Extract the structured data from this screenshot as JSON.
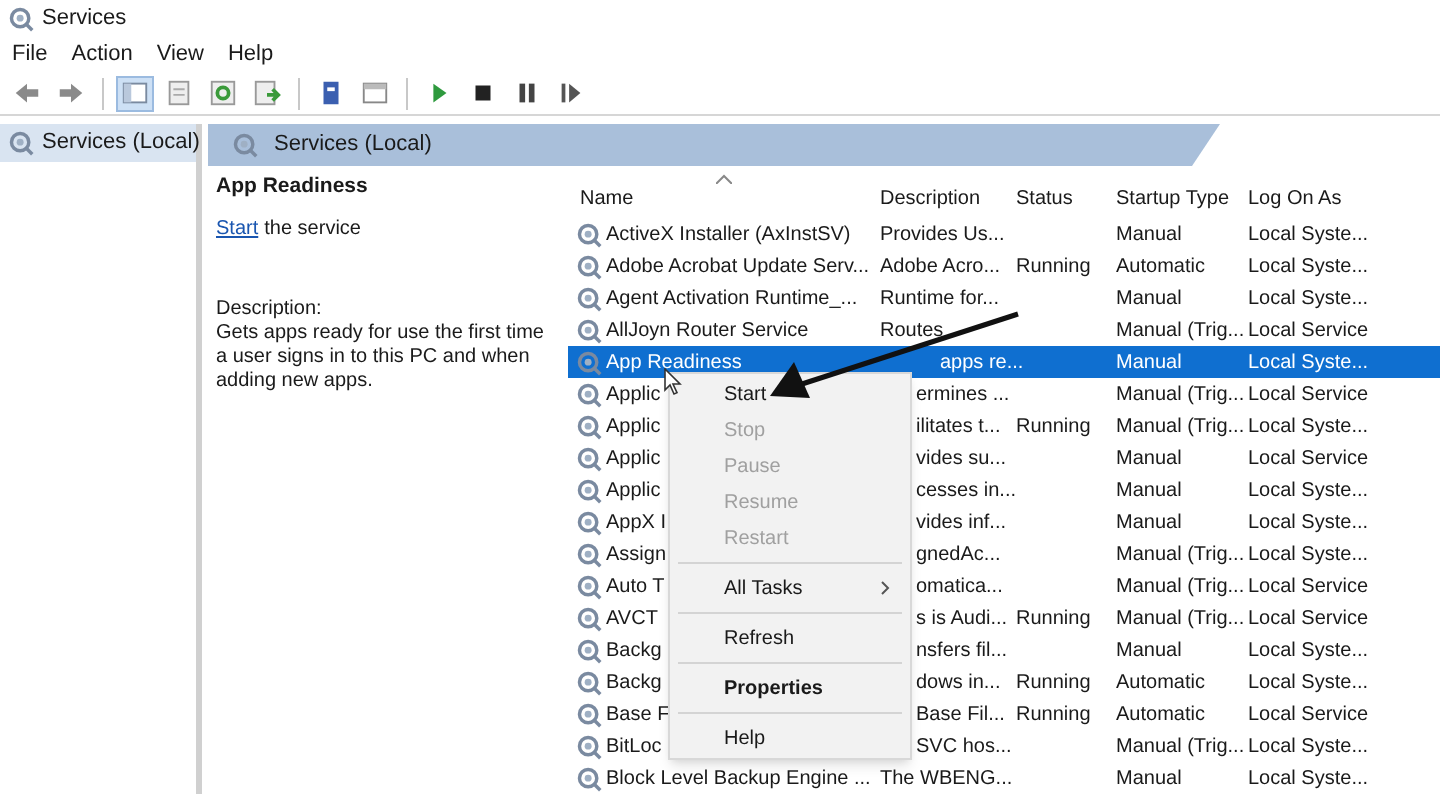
{
  "window": {
    "title": "Services"
  },
  "menu_bar": [
    "File",
    "Action",
    "View",
    "Help"
  ],
  "toolbar": [
    {
      "kind": "back",
      "selected": false
    },
    {
      "kind": "forward",
      "selected": false
    },
    {
      "kind": "sep"
    },
    {
      "kind": "tree",
      "selected": true
    },
    {
      "kind": "properties",
      "selected": false
    },
    {
      "kind": "refresh",
      "selected": false
    },
    {
      "kind": "export",
      "selected": false
    },
    {
      "kind": "sep"
    },
    {
      "kind": "help",
      "selected": false
    },
    {
      "kind": "view",
      "selected": false
    },
    {
      "kind": "sep"
    },
    {
      "kind": "play",
      "selected": false
    },
    {
      "kind": "stop",
      "selected": false
    },
    {
      "kind": "pause",
      "selected": false
    },
    {
      "kind": "resume",
      "selected": false
    }
  ],
  "tree": {
    "items": [
      {
        "label": "Services (Local)",
        "selected": true
      }
    ]
  },
  "pane_header": "Services (Local)",
  "details": {
    "title": "App Readiness",
    "action_link": "Start",
    "action_text": "the service",
    "description_label": "Description:",
    "description": "Gets apps ready for use the first time a user signs in to this PC and when adding new apps."
  },
  "table": {
    "columns": [
      "Name",
      "Description",
      "Status",
      "Startup Type",
      "Log On As"
    ],
    "rows": [
      {
        "cells": [
          "ActiveX Installer (AxInstSV)",
          "Provides Us...",
          "",
          "Manual",
          "Local Syste..."
        ],
        "selected": false
      },
      {
        "cells": [
          "Adobe Acrobat Update Serv...",
          "Adobe Acro...",
          "Running",
          "Automatic",
          "Local Syste..."
        ],
        "selected": false
      },
      {
        "cells": [
          "Agent Activation Runtime_...",
          "Runtime for...",
          "",
          "Manual",
          "Local Syste..."
        ],
        "selected": false
      },
      {
        "cells": [
          "AllJoyn Router Service",
          "Routes",
          "",
          "Manual (Trig...",
          "Local Service"
        ],
        "selected": false
      },
      {
        "cells": [
          "App Readiness",
          "apps re...",
          "",
          "Manual",
          "Local Syste..."
        ],
        "selected": true
      },
      {
        "cells": [
          "Applic",
          "ermines ...",
          "",
          "Manual (Trig...",
          "Local Service"
        ],
        "selected": false
      },
      {
        "cells": [
          "Applic",
          "ilitates t...",
          "Running",
          "Manual (Trig...",
          "Local Syste..."
        ],
        "selected": false
      },
      {
        "cells": [
          "Applic",
          "vides su...",
          "",
          "Manual",
          "Local Service"
        ],
        "selected": false
      },
      {
        "cells": [
          "Applic",
          "cesses in...",
          "",
          "Manual",
          "Local Syste..."
        ],
        "selected": false
      },
      {
        "cells": [
          "AppX I",
          "vides inf...",
          "",
          "Manual",
          "Local Syste..."
        ],
        "selected": false
      },
      {
        "cells": [
          "Assign",
          "gnedAc...",
          "",
          "Manual (Trig...",
          "Local Syste..."
        ],
        "selected": false
      },
      {
        "cells": [
          "Auto T",
          "omatica...",
          "",
          "Manual (Trig...",
          "Local Service"
        ],
        "selected": false
      },
      {
        "cells": [
          "AVCT",
          "s is Audi...",
          "Running",
          "Manual (Trig...",
          "Local Service"
        ],
        "selected": false
      },
      {
        "cells": [
          "Backg",
          "nsfers fil...",
          "",
          "Manual",
          "Local Syste..."
        ],
        "selected": false
      },
      {
        "cells": [
          "Backg",
          "dows in...",
          "Running",
          "Automatic",
          "Local Syste..."
        ],
        "selected": false
      },
      {
        "cells": [
          "Base F",
          "Base Fil...",
          "Running",
          "Automatic",
          "Local Service"
        ],
        "selected": false
      },
      {
        "cells": [
          "BitLoc",
          "SVC hos...",
          "",
          "Manual (Trig...",
          "Local Syste..."
        ],
        "selected": false
      },
      {
        "cells": [
          "Block Level Backup Engine ...",
          "The WBENG...",
          "",
          "Manual",
          "Local Syste..."
        ],
        "selected": false
      }
    ]
  },
  "context_menu": [
    {
      "kind": "item",
      "label": "Start",
      "disabled": false,
      "default": false,
      "submenu": false
    },
    {
      "kind": "item",
      "label": "Stop",
      "disabled": true,
      "default": false,
      "submenu": false
    },
    {
      "kind": "item",
      "label": "Pause",
      "disabled": true,
      "default": false,
      "submenu": false
    },
    {
      "kind": "item",
      "label": "Resume",
      "disabled": true,
      "default": false,
      "submenu": false
    },
    {
      "kind": "item",
      "label": "Restart",
      "disabled": true,
      "default": false,
      "submenu": false
    },
    {
      "kind": "separator"
    },
    {
      "kind": "item",
      "label": "All Tasks",
      "disabled": false,
      "default": false,
      "submenu": true
    },
    {
      "kind": "separator"
    },
    {
      "kind": "item",
      "label": "Refresh",
      "disabled": false,
      "default": false,
      "submenu": false
    },
    {
      "kind": "separator"
    },
    {
      "kind": "item",
      "label": "Properties",
      "disabled": false,
      "default": true,
      "submenu": false
    },
    {
      "kind": "separator"
    },
    {
      "kind": "item",
      "label": "Help",
      "disabled": false,
      "default": false,
      "submenu": false
    }
  ]
}
